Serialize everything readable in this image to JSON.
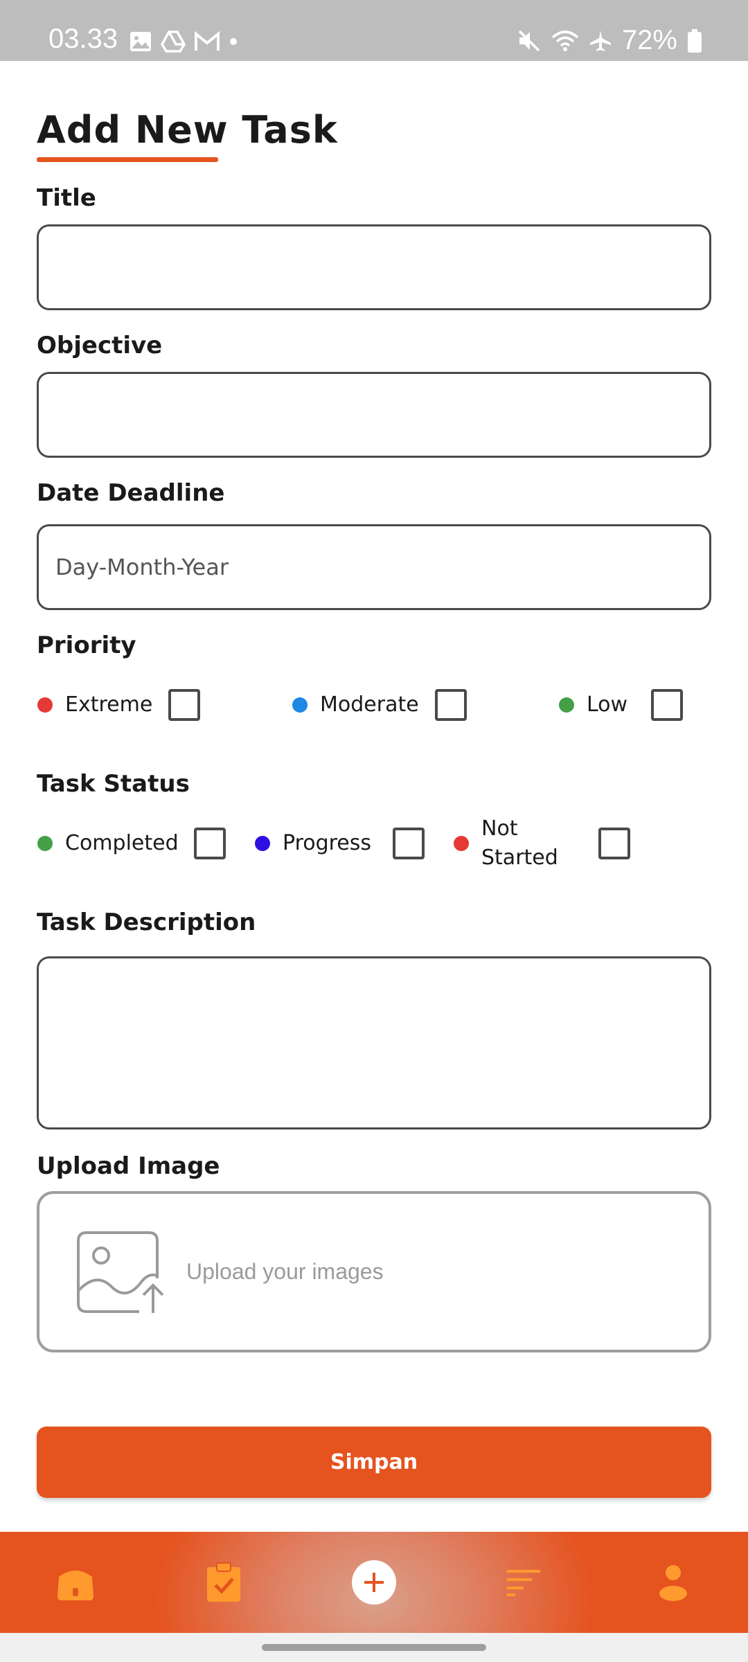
{
  "status_bar": {
    "time": "03.33",
    "battery": "72%"
  },
  "page": {
    "title": "Add New Task"
  },
  "form": {
    "title_label": "Title",
    "objective_label": "Objective",
    "deadline_label": "Date Deadline",
    "deadline_placeholder": "Day-Month-Year",
    "priority_label": "Priority",
    "priority_options": [
      {
        "label": "Extreme",
        "color": "#e53935"
      },
      {
        "label": "Moderate",
        "color": "#1e88e5"
      },
      {
        "label": "Low",
        "color": "#43a047"
      }
    ],
    "status_label": "Task Status",
    "status_options": [
      {
        "label": "Completed",
        "color": "#43a047"
      },
      {
        "label": "Progress",
        "color": "#2f10e0"
      },
      {
        "label": "Not Started",
        "color": "#e53935"
      }
    ],
    "description_label": "Task Description",
    "upload_label": "Upload Image",
    "upload_placeholder": "Upload your images",
    "save_label": "Simpan"
  },
  "bottom_nav": {
    "items": [
      "home-icon",
      "clipboard-check-icon",
      "add-icon",
      "filter-icon",
      "profile-icon"
    ]
  },
  "colors": {
    "accent": "#e5531f",
    "nav_icon": "#ff9a2e"
  }
}
